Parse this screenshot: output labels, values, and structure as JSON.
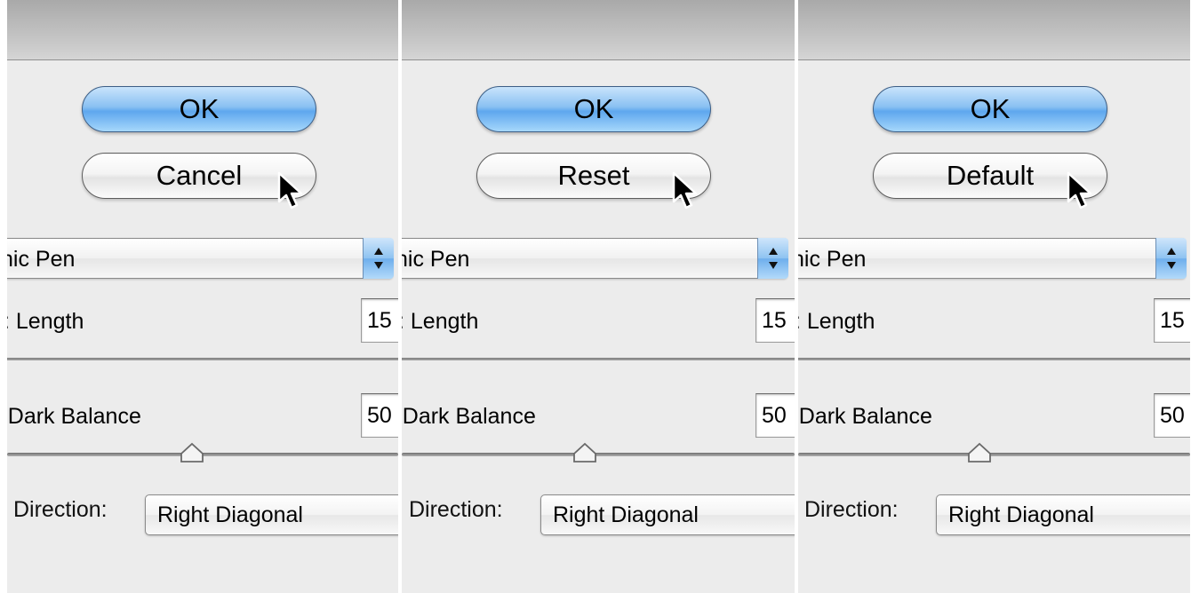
{
  "panels": [
    {
      "ok_label": "OK",
      "secondary_label": "Cancel",
      "filter_select_value": "hic Pen",
      "length_label": ": Length",
      "length_value": "15",
      "balance_label": "'Dark Balance",
      "balance_value": "50",
      "direction_label": "Direction:",
      "direction_value": "Right Diagonal"
    },
    {
      "ok_label": "OK",
      "secondary_label": "Reset",
      "filter_select_value": "hic Pen",
      "length_label": ": Length",
      "length_value": "15",
      "balance_label": "'Dark Balance",
      "balance_value": "50",
      "direction_label": "Direction:",
      "direction_value": "Right Diagonal"
    },
    {
      "ok_label": "OK",
      "secondary_label": "Default",
      "filter_select_value": "hic Pen",
      "length_label": ": Length",
      "length_value": "15",
      "balance_label": "'Dark Balance",
      "balance_value": "50",
      "direction_label": "Direction:",
      "direction_value": "Right Diagonal"
    }
  ],
  "colors": {
    "ok_button": "#89c0f2",
    "panel_bg": "#ececec",
    "titlebar": "#b8b8b8"
  },
  "icons": [
    "mouse-cursor-icon",
    "up-down-arrows-icon",
    "slider-thumb-icon"
  ]
}
